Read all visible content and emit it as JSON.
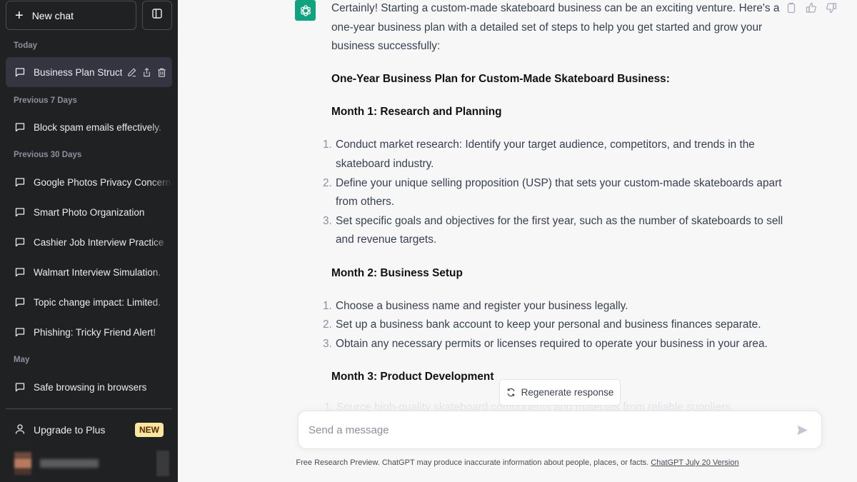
{
  "sidebar": {
    "new_chat_label": "New chat",
    "toggle_icon": "sidebar-toggle-icon",
    "sections": [
      {
        "label": "Today",
        "items": [
          {
            "title": "Business Plan Struct",
            "active": true
          }
        ]
      },
      {
        "label": "Previous 7 Days",
        "items": [
          {
            "title": "Block spam emails effectively."
          }
        ]
      },
      {
        "label": "Previous 30 Days",
        "items": [
          {
            "title": "Google Photos Privacy Concerns"
          },
          {
            "title": "Smart Photo Organization"
          },
          {
            "title": "Cashier Job Interview Practice"
          },
          {
            "title": "Walmart Interview Simulation."
          },
          {
            "title": "Topic change impact: Limited."
          },
          {
            "title": "Phishing: Tricky Friend Alert!"
          }
        ]
      },
      {
        "label": "May",
        "items": [
          {
            "title": "Safe browsing in browsers"
          }
        ]
      }
    ],
    "upgrade_label": "Upgrade to Plus",
    "upgrade_badge": "NEW"
  },
  "message": {
    "intro": "Certainly! Starting a custom-made skateboard business can be an exciting venture. Here's a one-year business plan with a detailed set of steps to help you get started and grow your business successfully:",
    "plan_title": "One-Year Business Plan for Custom-Made Skateboard Business:",
    "months": [
      {
        "heading": "Month 1: Research and Planning",
        "steps": [
          "Conduct market research: Identify your target audience, competitors, and trends in the skateboard industry.",
          "Define your unique selling proposition (USP) that sets your custom-made skateboards apart from others.",
          "Set specific goals and objectives for the first year, such as the number of skateboards to sell and revenue targets."
        ]
      },
      {
        "heading": "Month 2: Business Setup",
        "steps": [
          "Choose a business name and register your business legally.",
          "Set up a business bank account to keep your personal and business finances separate.",
          "Obtain any necessary permits or licenses required to operate your business in your area."
        ]
      },
      {
        "heading": "Month 3: Product Development",
        "steps": []
      }
    ],
    "faded_line": "1.  Source high-quality skateboard components and materials from reliable suppliers."
  },
  "regenerate_label": "Regenerate response",
  "composer": {
    "placeholder": "Send a message",
    "value": ""
  },
  "footer": {
    "text": "Free Research Preview. ChatGPT may produce inaccurate information about people, places, or facts. ",
    "link": "ChatGPT July 20 Version"
  },
  "colors": {
    "sidebar_bg": "#202123",
    "active_item_bg": "#343541",
    "brand_green": "#10a37f",
    "badge_bg": "#fae69e",
    "main_bg": "#f7f7f8"
  }
}
